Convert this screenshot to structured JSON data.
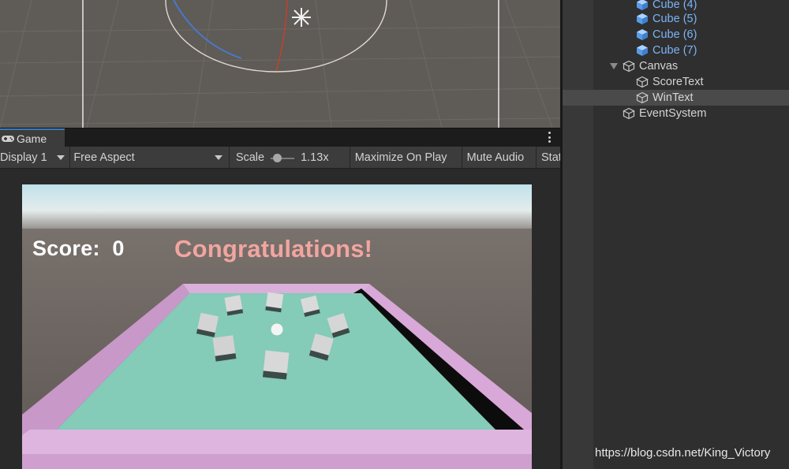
{
  "game_tab": {
    "label": "Game",
    "icon": "gamepad-icon"
  },
  "toolbar": {
    "display": "Display 1",
    "aspect": "Free Aspect",
    "scale_label": "Scale",
    "scale_value": "1.13x",
    "scale_slider_fraction": 0.13,
    "maximize": "Maximize On Play",
    "mute": "Mute Audio",
    "stats": "Stats"
  },
  "game_ui": {
    "score_text": "Score:  0",
    "win_text": "Congratulations!"
  },
  "hierarchy": {
    "items": [
      {
        "label": "Cube (4)",
        "icon": "prefab-cube-icon",
        "prefab": true
      },
      {
        "label": "Cube (5)",
        "icon": "prefab-cube-icon",
        "prefab": true
      },
      {
        "label": "Cube (6)",
        "icon": "prefab-cube-icon",
        "prefab": true
      },
      {
        "label": "Cube (7)",
        "icon": "prefab-cube-icon",
        "prefab": true
      },
      {
        "label": "Canvas",
        "icon": "gameobject-cube-icon",
        "expanded": true
      },
      {
        "label": "ScoreText",
        "icon": "gameobject-cube-icon"
      },
      {
        "label": "WinText",
        "icon": "gameobject-cube-icon",
        "selected": true
      },
      {
        "label": "EventSystem",
        "icon": "gameobject-cube-icon"
      }
    ]
  },
  "watermark": "https://blog.csdn.net/King_Victory",
  "colors": {
    "accent": "#3a79bb",
    "prefab_text": "#7cb4f6",
    "win_text": "#f2a5a0",
    "board_floor": "#84cbb8",
    "board_wall": "#d8a8d8"
  }
}
